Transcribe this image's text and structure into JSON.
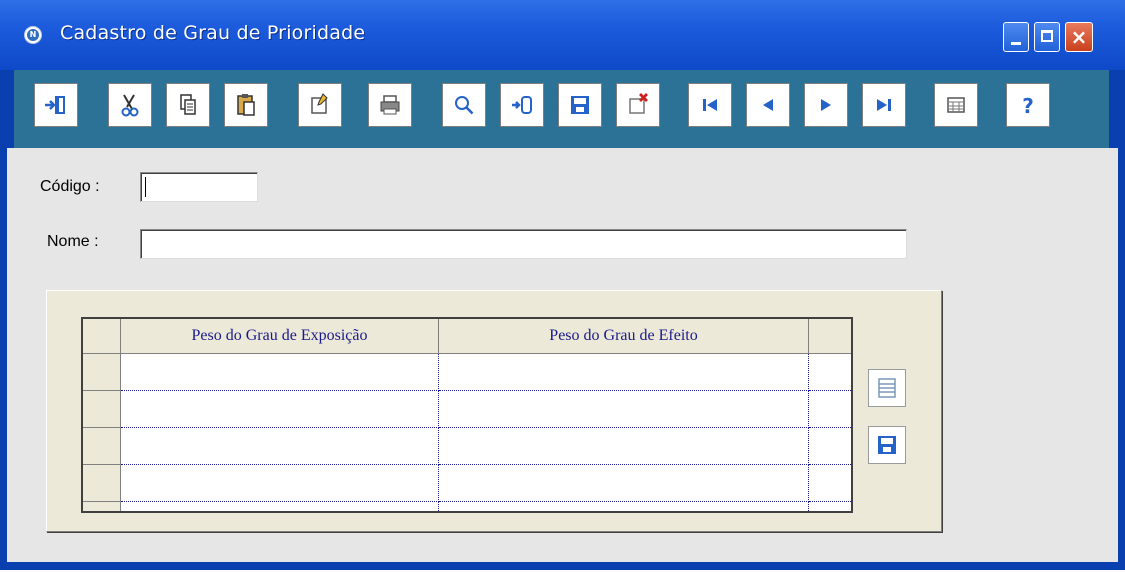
{
  "window": {
    "title": "Cadastro de Grau de Prioridade",
    "controls": {
      "minimize": "minimize",
      "maximize": "maximize",
      "close": "×"
    }
  },
  "toolbar": {
    "buttons": [
      {
        "icon": "exit-door-icon",
        "glyph": "→▯"
      },
      {
        "icon": "cut-icon",
        "glyph": "✂"
      },
      {
        "icon": "copy-icon",
        "glyph": "❐"
      },
      {
        "icon": "paste-icon",
        "glyph": "📋"
      },
      {
        "icon": "new-record-icon",
        "glyph": "▢"
      },
      {
        "icon": "print-icon",
        "glyph": "▭"
      },
      {
        "icon": "search-icon",
        "glyph": "🔍"
      },
      {
        "icon": "insert-icon",
        "glyph": "→▯"
      },
      {
        "icon": "save-icon",
        "glyph": "💾"
      },
      {
        "icon": "delete-record-icon",
        "glyph": "✖"
      },
      {
        "icon": "first-record-icon",
        "glyph": "⏮"
      },
      {
        "icon": "previous-record-icon",
        "glyph": "◀"
      },
      {
        "icon": "next-record-icon",
        "glyph": "▶"
      },
      {
        "icon": "last-record-icon",
        "glyph": "⏭"
      },
      {
        "icon": "grid-view-icon",
        "glyph": "▦"
      },
      {
        "icon": "help-icon",
        "glyph": "?"
      }
    ]
  },
  "form": {
    "codigo_label": "Código :",
    "codigo_value": "",
    "nome_label": "Nome :",
    "nome_value": ""
  },
  "grid": {
    "columns": [
      "Peso do Grau de Exposição",
      "Peso do Grau de Efeito"
    ],
    "rows": [
      [
        "",
        ""
      ],
      [
        "",
        ""
      ],
      [
        "",
        ""
      ],
      [
        "",
        ""
      ],
      [
        "",
        ""
      ]
    ]
  },
  "side_buttons": [
    {
      "icon": "list-icon"
    },
    {
      "icon": "save-icon"
    }
  ],
  "colors": {
    "titlebar": "#1b5bdc",
    "toolbar": "#2b7296",
    "client": "#e6e6e6",
    "panel": "#ece9d8",
    "grid_header_text": "#1a1a8c"
  }
}
